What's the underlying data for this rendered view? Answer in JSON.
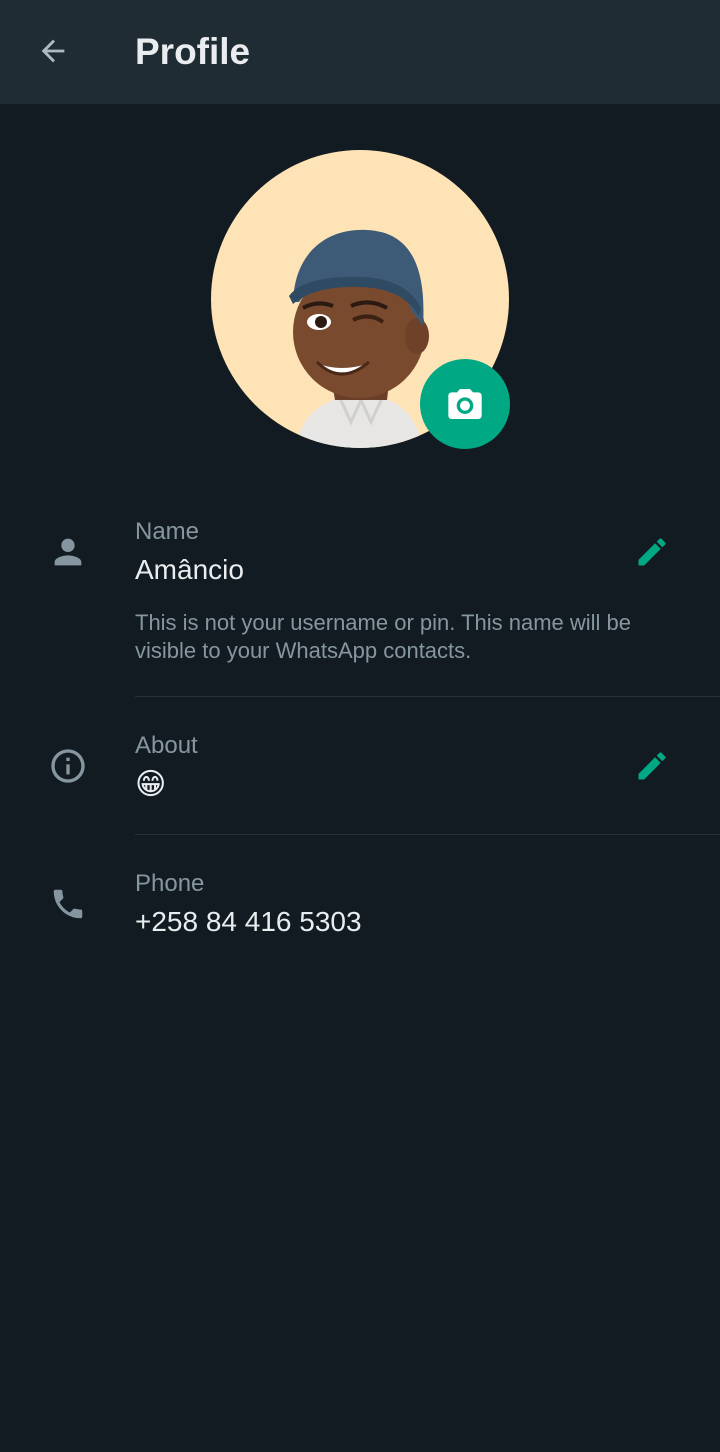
{
  "header": {
    "title": "Profile",
    "back_icon": "arrow-left-icon"
  },
  "avatar": {
    "background": "#fde3b5",
    "camera_icon": "camera-icon",
    "camera_bg": "#00a884"
  },
  "fields": {
    "name": {
      "label": "Name",
      "value": "Amâncio",
      "hint": "This is not your username or pin. This name will be visible to your WhatsApp contacts.",
      "icon": "person-icon",
      "edit_icon": "pencil-icon"
    },
    "about": {
      "label": "About",
      "value": "😁",
      "icon": "info-icon",
      "edit_icon": "pencil-icon"
    },
    "phone": {
      "label": "Phone",
      "value": "+258 84 416 5303",
      "icon": "phone-icon"
    }
  },
  "colors": {
    "background": "#121b22",
    "appbar": "#1f2c34",
    "accent": "#00a884",
    "secondary_text": "#8696a0",
    "primary_text": "#e9edef"
  }
}
